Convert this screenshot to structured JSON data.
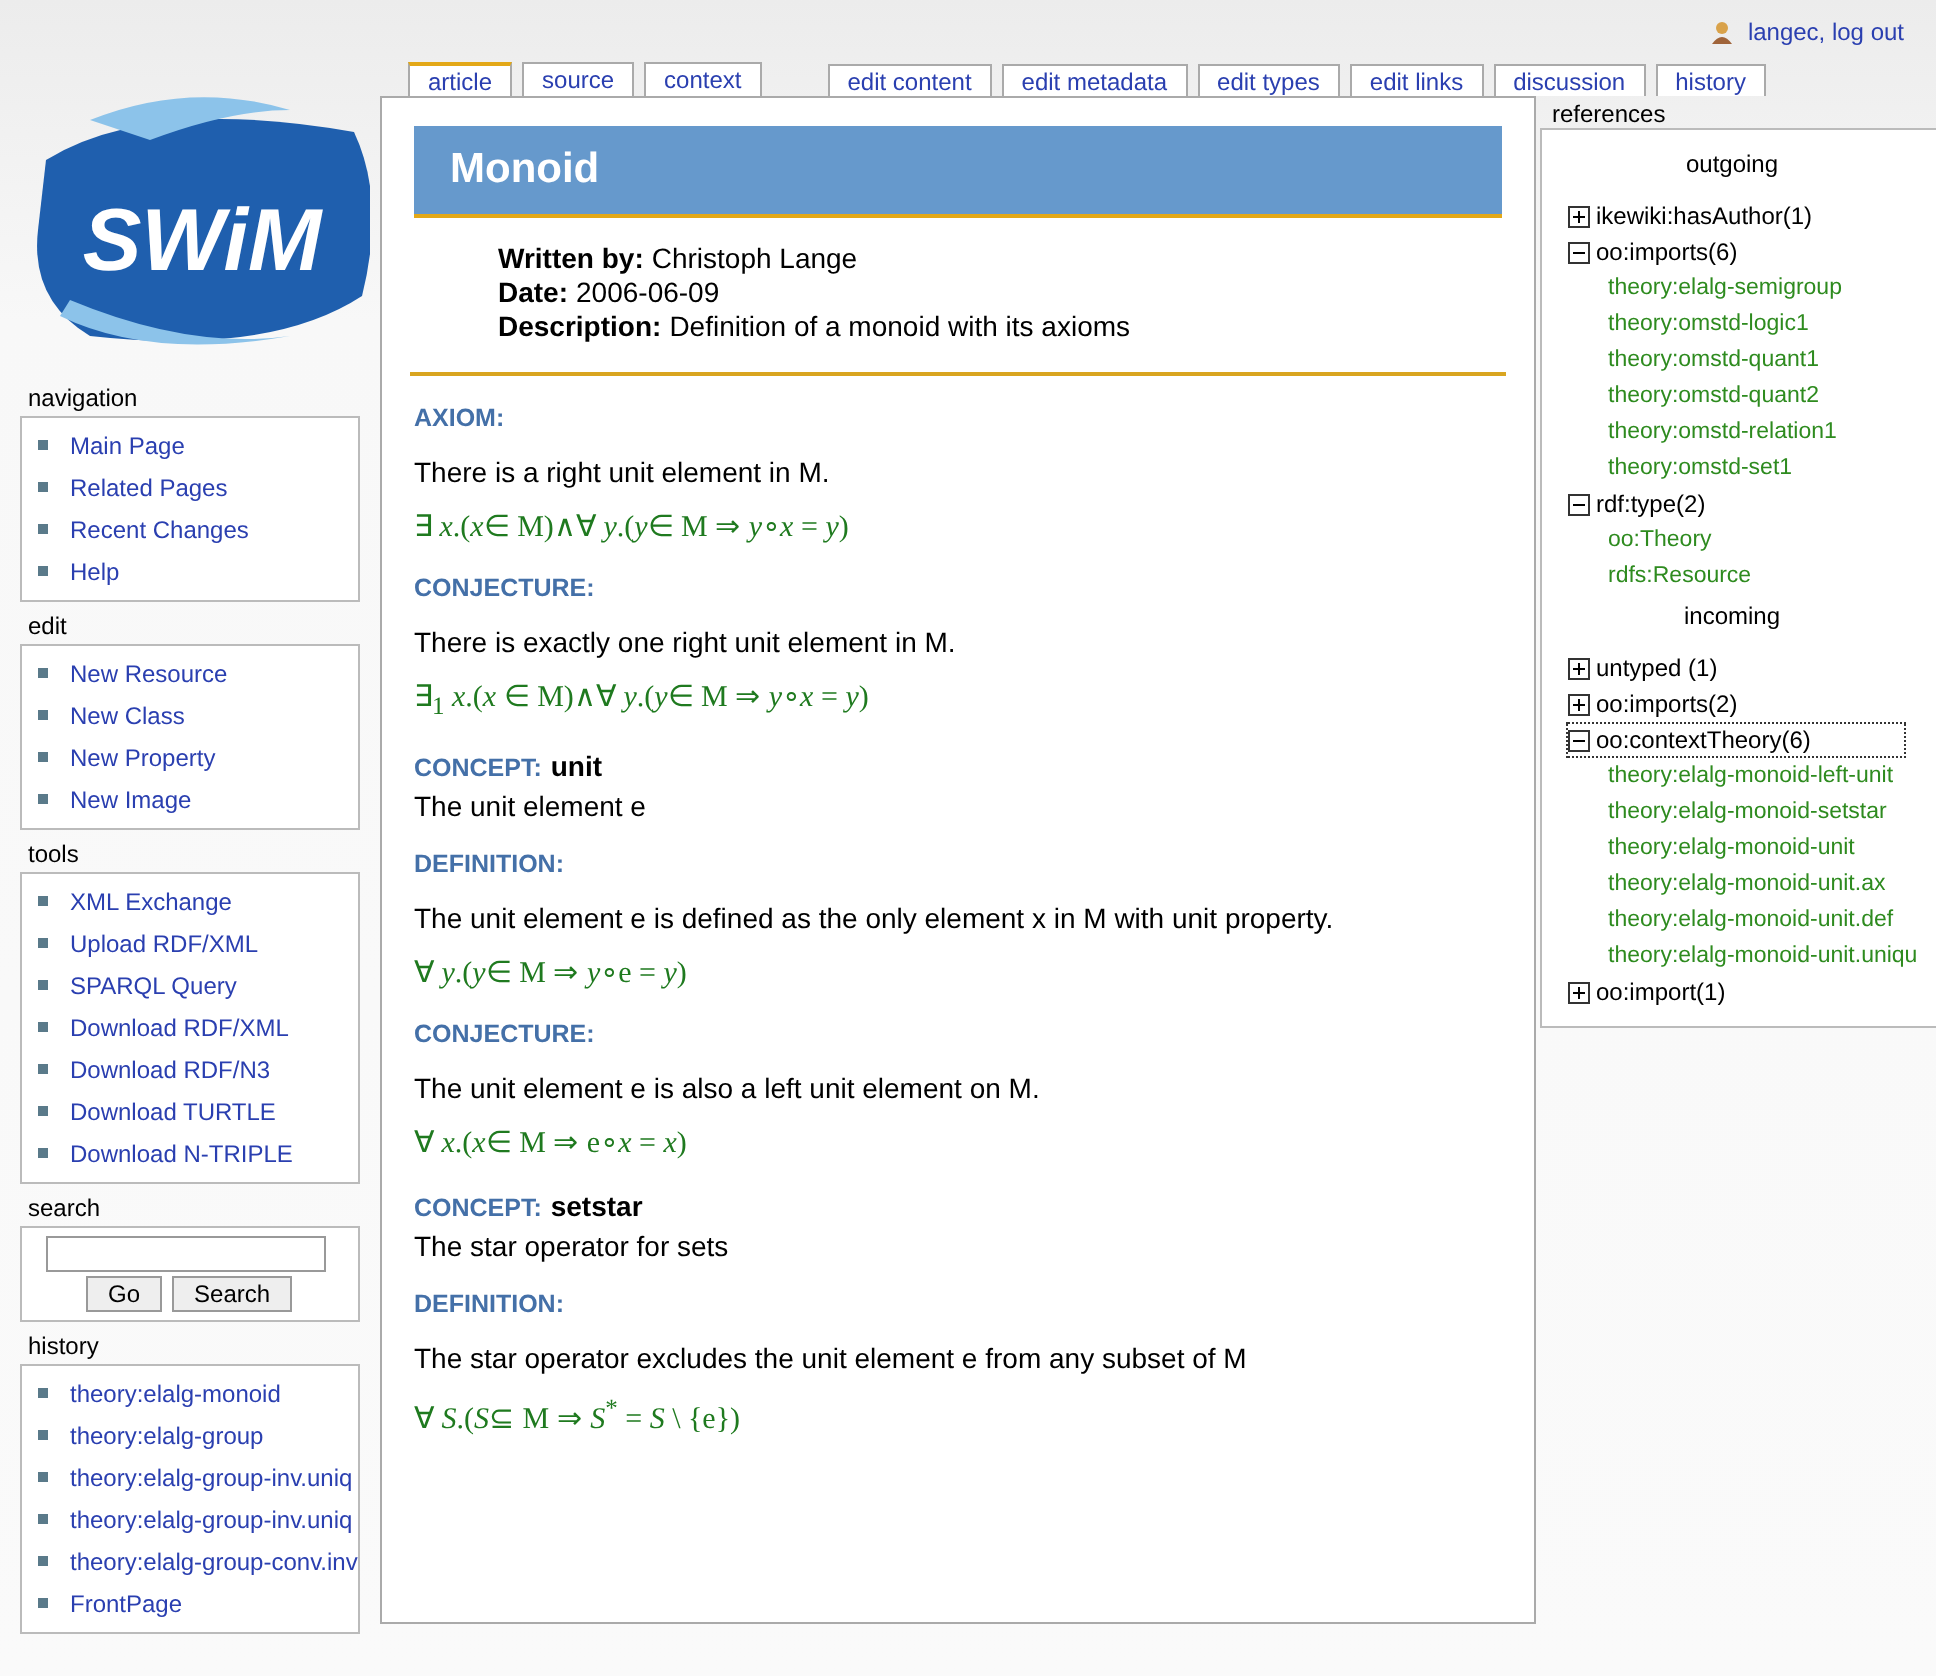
{
  "logo_text": "SWiM",
  "user": {
    "label": "langec, log out"
  },
  "tab_groups": [
    [
      {
        "label": "article",
        "selected": true
      },
      {
        "label": "source",
        "selected": false
      },
      {
        "label": "context",
        "selected": false
      }
    ],
    [
      {
        "label": "edit content",
        "selected": false
      },
      {
        "label": "edit metadata",
        "selected": false
      },
      {
        "label": "edit types",
        "selected": false
      },
      {
        "label": "edit links",
        "selected": false
      },
      {
        "label": "discussion",
        "selected": false
      },
      {
        "label": "history",
        "selected": false
      }
    ]
  ],
  "sidebar": [
    {
      "title": "navigation",
      "items": [
        "Main Page",
        "Related Pages",
        "Recent Changes",
        "Help"
      ]
    },
    {
      "title": "edit",
      "items": [
        "New Resource",
        "New Class",
        "New Property",
        "New Image"
      ]
    },
    {
      "title": "tools",
      "items": [
        "XML Exchange",
        "Upload RDF/XML",
        "SPARQL Query",
        "Download RDF/XML",
        "Download RDF/N3",
        "Download TURTLE",
        "Download N-TRIPLE"
      ]
    },
    {
      "title": "search",
      "kind": "search",
      "buttons": [
        "Go",
        "Search"
      ]
    },
    {
      "title": "history",
      "items": [
        "theory:elalg-monoid",
        "theory:elalg-group",
        "theory:elalg-group-inv.uniq",
        "theory:elalg-group-inv.uniq",
        "theory:elalg-group-conv.inv",
        "FrontPage"
      ]
    }
  ],
  "article": {
    "title": "Monoid",
    "meta": [
      {
        "label": "Written by:",
        "value": "Christoph Lange"
      },
      {
        "label": "Date:",
        "value": "2006-06-09"
      },
      {
        "label": "Description:",
        "value": "Definition of a monoid with its axioms"
      }
    ],
    "blocks": [
      {
        "kind": "statement",
        "type": "AXIOM:",
        "text": "There is a right unit element in M.",
        "formula": "∃ *x*.(*x*∈ M)∧∀ *y*.(*y*∈ M ⇒ *y*∘*x* = *y*)"
      },
      {
        "kind": "statement",
        "type": "CONJECTURE:",
        "text": "There is exactly one right unit element in M.",
        "formula": "∃$_{1}$ *x*.(*x* ∈ M)∧∀ *y*.(*y*∈ M ⇒ *y*∘*x* = *y*)"
      },
      {
        "kind": "concept",
        "type": "CONCEPT:",
        "name": "unit",
        "text": "The unit element e"
      },
      {
        "kind": "statement",
        "type": "DEFINITION:",
        "text": "The unit element e is defined as the only element x in M with unit property.",
        "formula": "∀ *y*.(*y*∈ M ⇒ *y*∘e = *y*)"
      },
      {
        "kind": "statement",
        "type": "CONJECTURE:",
        "text": "The unit element e is also a left unit element on M.",
        "formula": "∀ *x*.(*x*∈ M ⇒ e∘*x* = *x*)"
      },
      {
        "kind": "concept",
        "type": "CONCEPT:",
        "name": "setstar",
        "text": "The star operator for sets"
      },
      {
        "kind": "statement",
        "type": "DEFINITION:",
        "text": "The star operator excludes the unit element e from any subset of M",
        "formula": "∀ *S*.(*S*⊆ M ⇒ *S*$^{*}$ = *S* \\ {e})"
      }
    ]
  },
  "references": {
    "title": "references",
    "sections": [
      {
        "title": "outgoing",
        "groups": [
          {
            "label": "ikewiki:hasAuthor(1)",
            "expanded": false,
            "focused": false
          },
          {
            "label": "oo:imports(6)",
            "expanded": true,
            "focused": false,
            "items": [
              "theory:elalg-semigroup",
              "theory:omstd-logic1",
              "theory:omstd-quant1",
              "theory:omstd-quant2",
              "theory:omstd-relation1",
              "theory:omstd-set1"
            ]
          },
          {
            "label": "rdf:type(2)",
            "expanded": true,
            "focused": false,
            "items": [
              "oo:Theory",
              "rdfs:Resource"
            ]
          }
        ]
      },
      {
        "title": "incoming",
        "groups": [
          {
            "label": "untyped (1)",
            "expanded": false,
            "focused": false
          },
          {
            "label": "oo:imports(2)",
            "expanded": false,
            "focused": false
          },
          {
            "label": "oo:contextTheory(6)",
            "expanded": true,
            "focused": true,
            "items": [
              "theory:elalg-monoid-left-unit",
              "theory:elalg-monoid-setstar",
              "theory:elalg-monoid-unit",
              "theory:elalg-monoid-unit.ax",
              "theory:elalg-monoid-unit.def",
              "theory:elalg-monoid-unit.uniqu"
            ]
          },
          {
            "label": "oo:import(1)",
            "expanded": false,
            "focused": false
          }
        ]
      }
    ]
  }
}
